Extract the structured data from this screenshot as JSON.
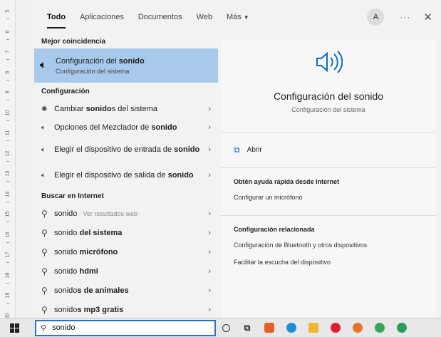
{
  "ruler": [
    "5",
    "6",
    "7",
    "8",
    "9",
    "10",
    "11",
    "12",
    "13",
    "14",
    "15",
    "16",
    "17",
    "18",
    "19",
    "20"
  ],
  "tabs": [
    {
      "label": "Todo"
    },
    {
      "label": "Aplicaciones"
    },
    {
      "label": "Documentos"
    },
    {
      "label": "Web"
    },
    {
      "label": "Más"
    }
  ],
  "header": {
    "avatar": "A",
    "more": "···",
    "close": "✕"
  },
  "best": {
    "section": "Mejor coincidencia",
    "title": "Configuración del ",
    "title_bold": "sonido",
    "subtitle": "Configuración del sistema"
  },
  "settings": {
    "section": "Configuración",
    "items": [
      {
        "pre": "Cambiar ",
        "bold": "sonido",
        "post": "s del sistema"
      },
      {
        "pre": "Opciones del Mezclador de ",
        "bold": "sonido",
        "post": ""
      },
      {
        "pre": "Elegir el dispositivo de entrada de ",
        "bold": "sonido",
        "post": ""
      },
      {
        "pre": "Elegir el dispositivo de salida de ",
        "bold": "sonido",
        "post": ""
      }
    ]
  },
  "web": {
    "section": "Buscar en Internet",
    "items": [
      {
        "pre": "sonido",
        "bold": "",
        "post": "",
        "muted": " - Ver resultados web"
      },
      {
        "pre": "sonido ",
        "bold": "del sistema",
        "post": "",
        "muted": ""
      },
      {
        "pre": "sonido ",
        "bold": "micrófono",
        "post": "",
        "muted": ""
      },
      {
        "pre": "sonido ",
        "bold": "hdmi",
        "post": "",
        "muted": ""
      },
      {
        "pre": "sonido",
        "bold": "s de animales",
        "post": "",
        "muted": ""
      },
      {
        "pre": "sonido",
        "bold": "s mp3 gratis",
        "post": "",
        "muted": ""
      }
    ]
  },
  "pane": {
    "title": "Configuración del sonido",
    "subtitle": "Configuración del sistema",
    "open": "Abrir",
    "help_heading": "Obtén ayuda rápida desde Internet",
    "help_links": [
      "Configurar un micrófono"
    ],
    "related_heading": "Configuración relacionada",
    "related_links": [
      "Configuración de Bluetooth y otros dispositivos",
      "Facilitar la escucha del dispositivo"
    ]
  },
  "taskbar": {
    "search_value": "sonido"
  },
  "colors": {
    "accent": "#0b6dc7",
    "selected": "#a8c9ec",
    "search_border": "#2a73c5"
  }
}
